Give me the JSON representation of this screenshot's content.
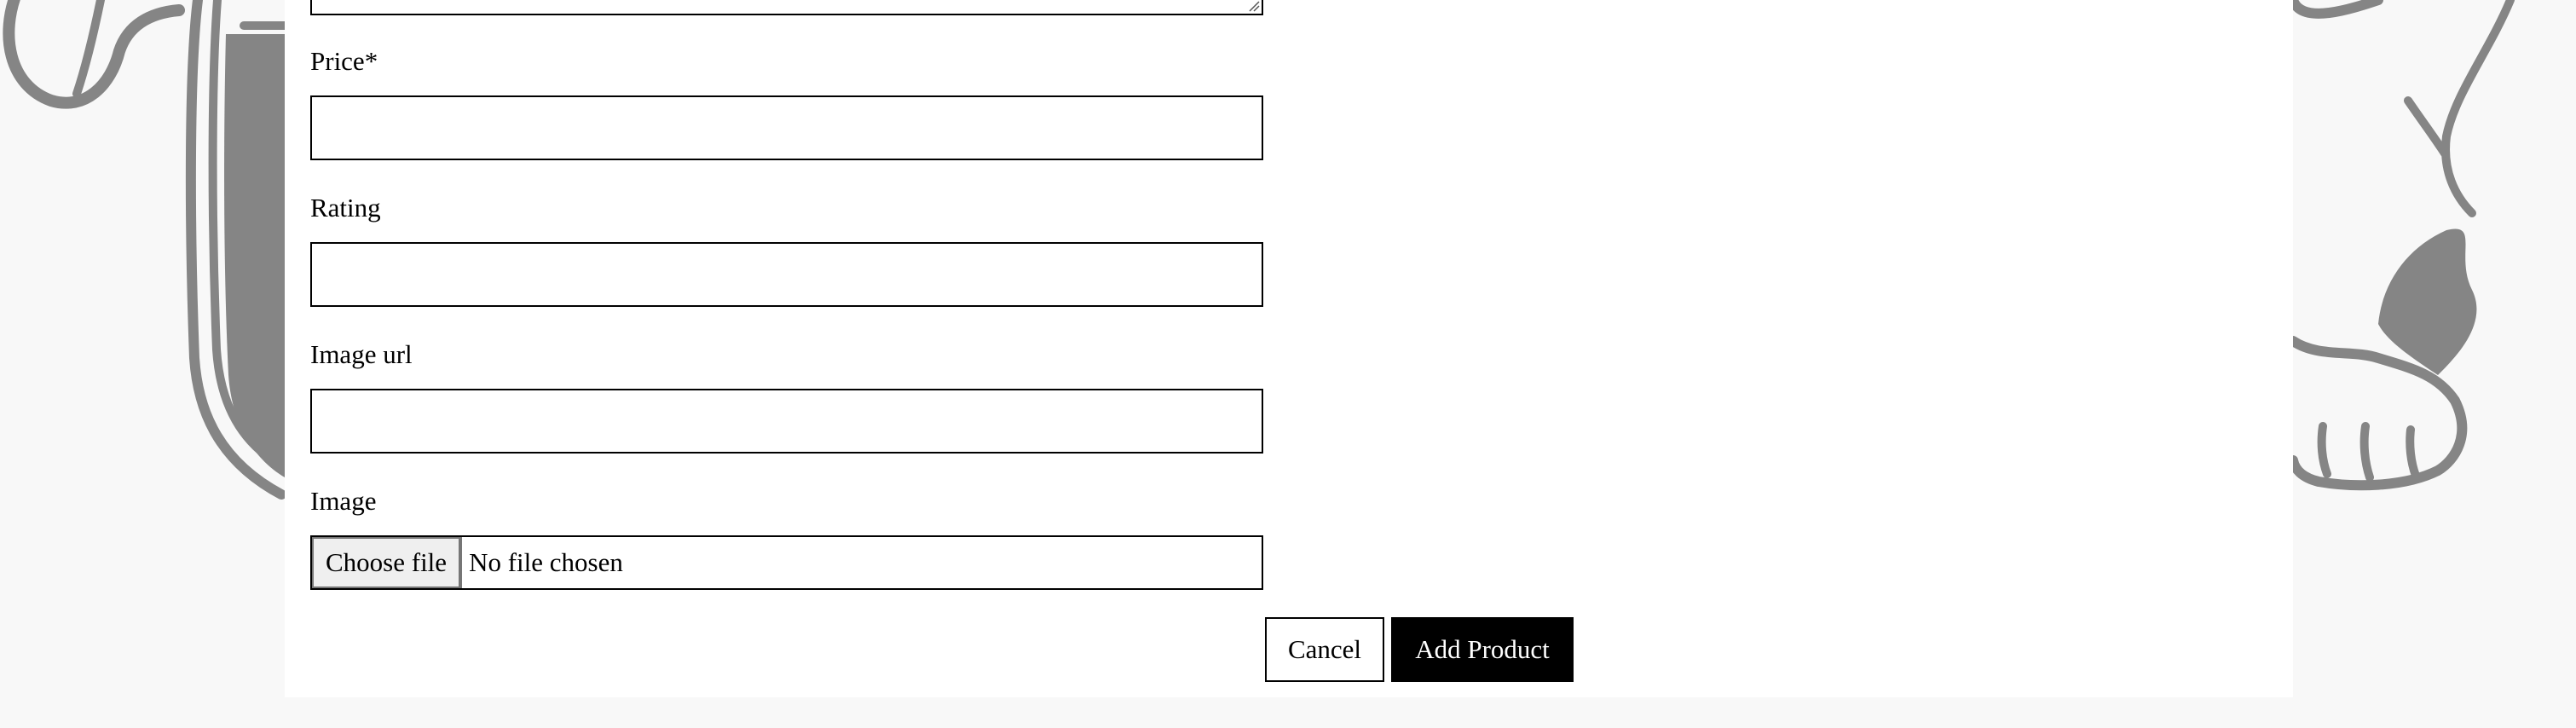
{
  "form": {
    "fields": [
      {
        "label": "Price*",
        "value": "",
        "placeholder": ""
      },
      {
        "label": "Rating",
        "value": "",
        "placeholder": ""
      },
      {
        "label": "Image url",
        "value": "",
        "placeholder": ""
      }
    ],
    "image": {
      "label": "Image",
      "button_label": "Choose file",
      "status": "No file chosen"
    },
    "actions": {
      "cancel_label": "Cancel",
      "submit_label": "Add Product"
    }
  },
  "colors": {
    "page_background": "#f8f8f8",
    "panel_background": "#ffffff",
    "illustration": "#858585",
    "primary_button": "#000000"
  },
  "illustration": {
    "left": "cat-tail-icon",
    "right": "cat-paw-icon"
  }
}
